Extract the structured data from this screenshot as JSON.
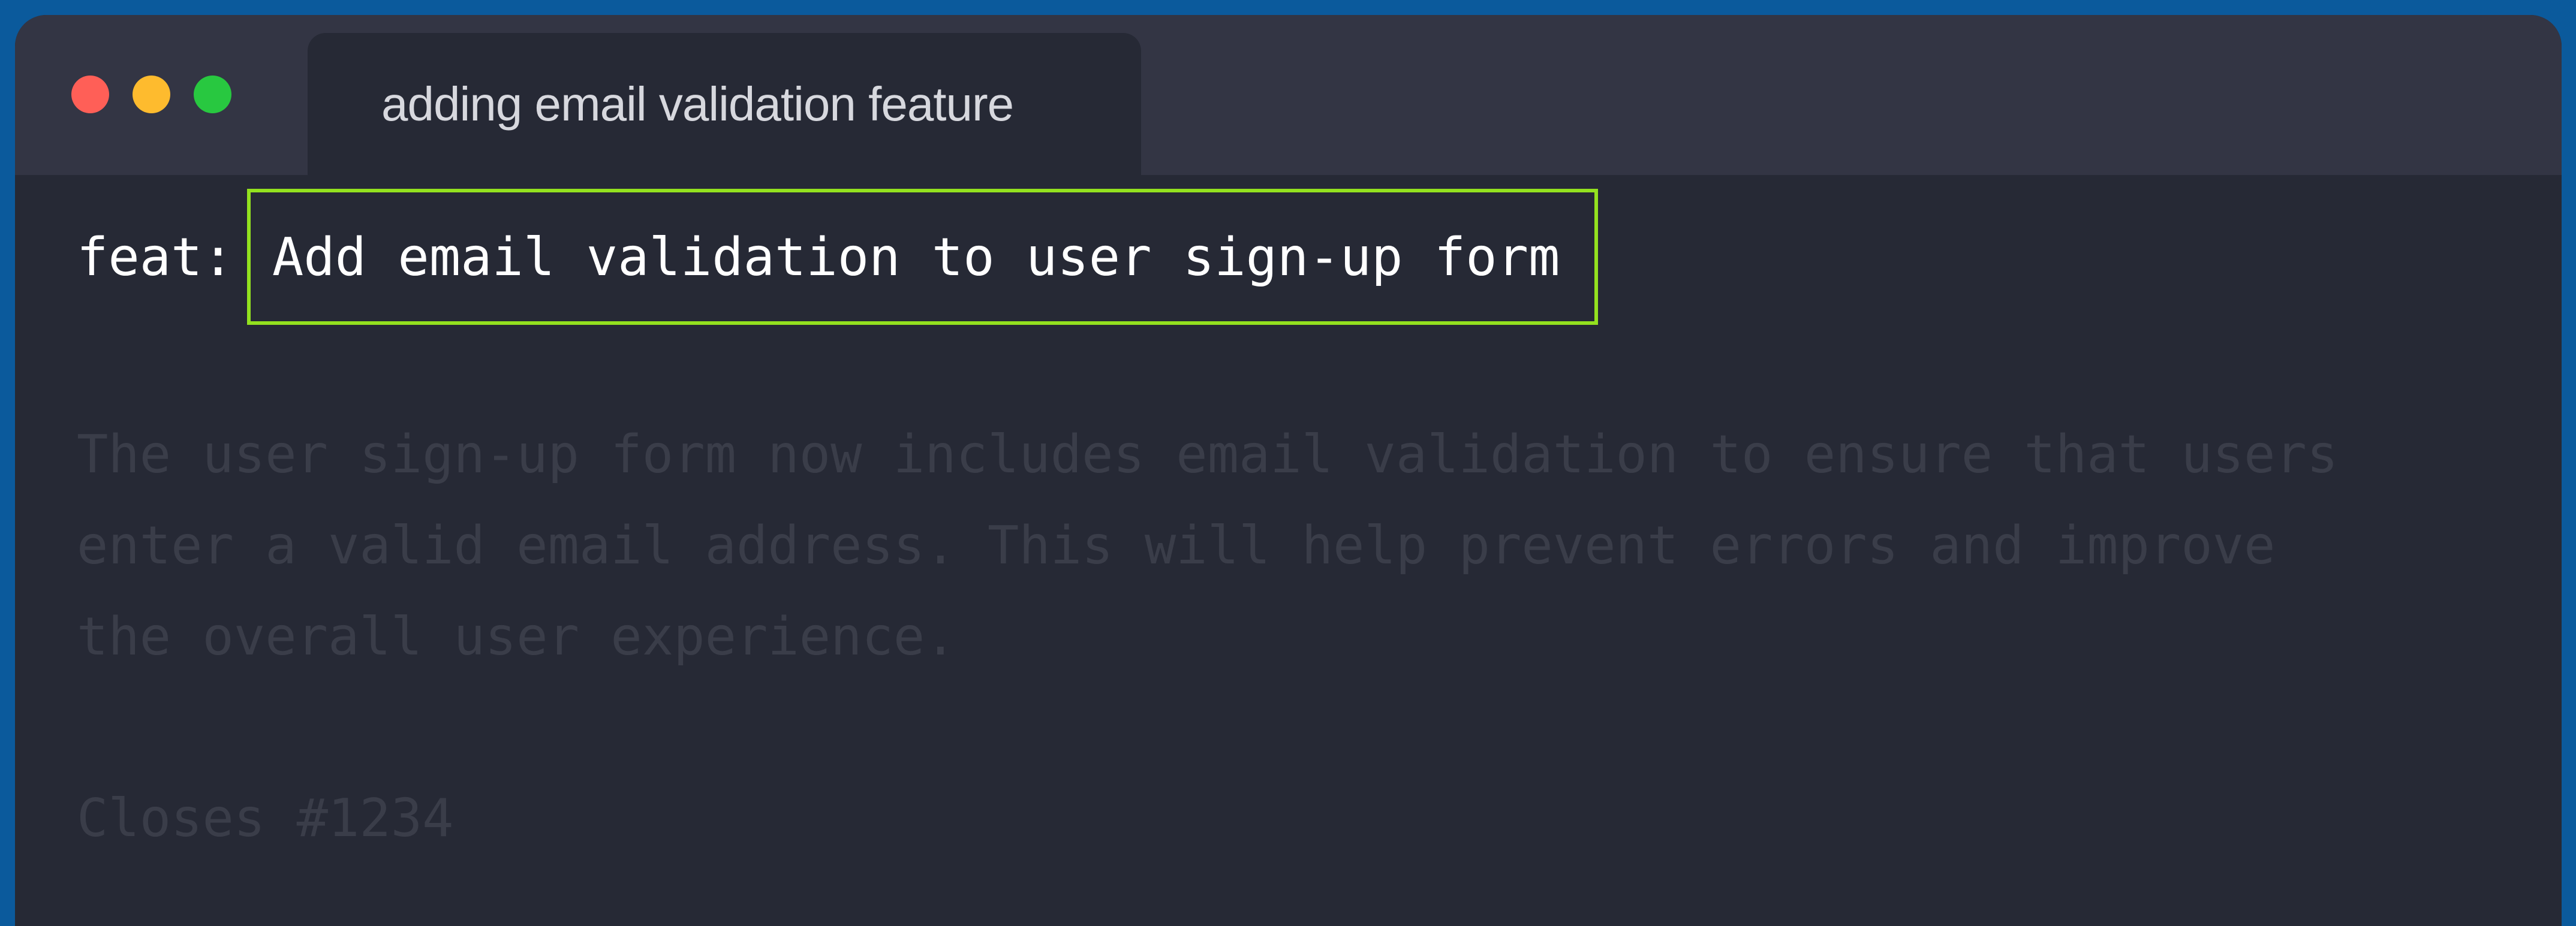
{
  "window": {
    "tab_title": "adding email validation feature"
  },
  "editor": {
    "prefix": "feat:",
    "subject": "Add email validation to user sign-up form",
    "body_lines": [
      "The user sign-up form now includes email validation to ensure that users",
      "enter a valid email address. This will help prevent errors and improve",
      "the overall user experience."
    ],
    "footer": "Closes #1234"
  },
  "colors": {
    "background": "#0b5a9c",
    "titlebar": "#333544",
    "editor": "#262935",
    "highlight": "#93e11f",
    "close": "#ff5f57",
    "minimize": "#febb2e",
    "zoom": "#28c840"
  }
}
